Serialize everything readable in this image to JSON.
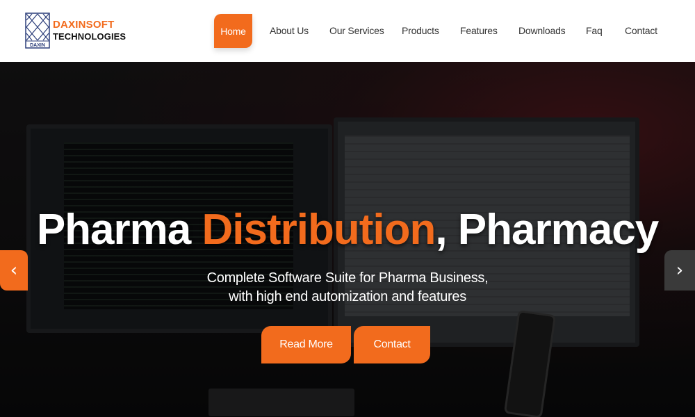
{
  "logo": {
    "mark_text": "DAXIN",
    "brand": "DAXINSOFT",
    "sub": "TECHNOLOGIES"
  },
  "nav": {
    "items": [
      {
        "label": "Home",
        "active": true
      },
      {
        "label": "About Us"
      },
      {
        "label": "Our Services"
      },
      {
        "label": "Products"
      },
      {
        "label": "Features"
      },
      {
        "label": "Downloads"
      },
      {
        "label": "Faq"
      },
      {
        "label": "Contact"
      }
    ]
  },
  "hero": {
    "title_part1": "Pharma ",
    "title_accent": "Distribution",
    "title_part2": ", Pharmacy",
    "subtitle_line1": "Complete Software Suite for Pharma Business,",
    "subtitle_line2": "with high end automization and features",
    "read_more": "Read More",
    "contact": "Contact",
    "prev_icon": "chevron-left-icon",
    "next_icon": "chevron-right-icon"
  },
  "colors": {
    "accent": "#f26b1d",
    "nav_text": "#333333",
    "slider_next_bg": "#3a3a3a"
  }
}
